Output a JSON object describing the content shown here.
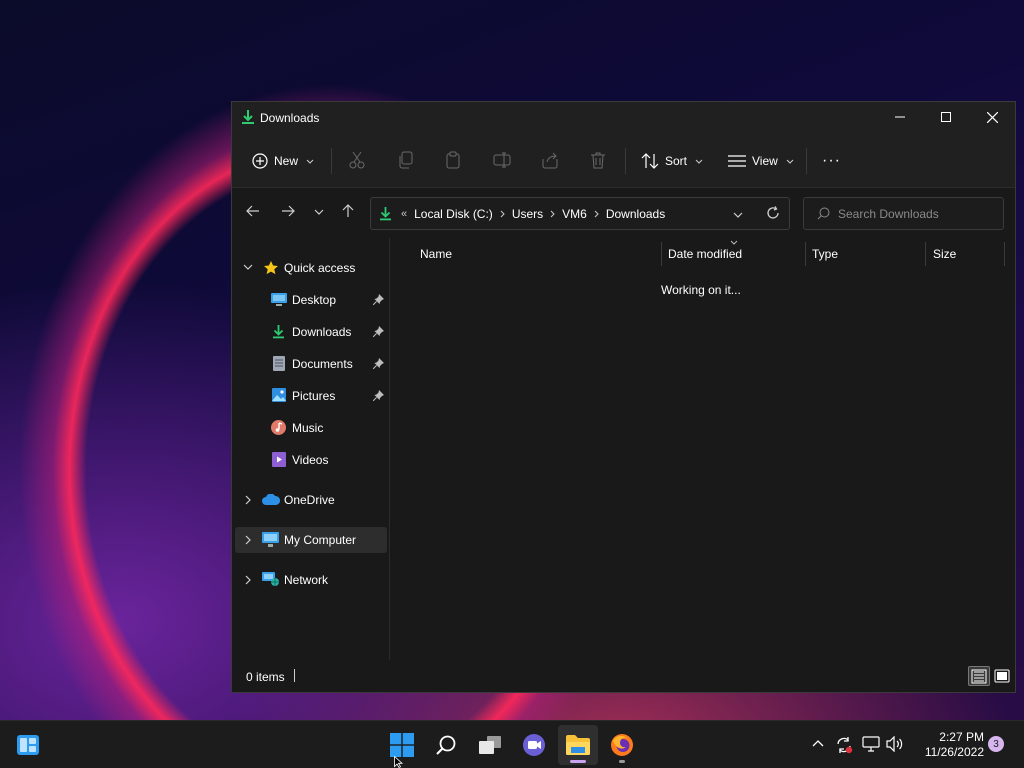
{
  "window": {
    "title": "Downloads"
  },
  "toolbar": {
    "new_label": "New",
    "sort_label": "Sort",
    "view_label": "View",
    "more_label": "···"
  },
  "address": {
    "overflow": "«",
    "crumbs": [
      "Local Disk (C:)",
      "Users",
      "VM6",
      "Downloads"
    ],
    "search_placeholder": "Search Downloads"
  },
  "nav": {
    "quick_access": "Quick access",
    "pinned": [
      "Desktop",
      "Downloads",
      "Documents",
      "Pictures"
    ],
    "music": "Music",
    "videos": "Videos",
    "onedrive": "OneDrive",
    "my_computer": "My Computer",
    "network": "Network"
  },
  "content": {
    "columns": [
      "Name",
      "Date modified",
      "Type",
      "Size"
    ],
    "status_message": "Working on it..."
  },
  "statusbar": {
    "item_count": "0 items"
  },
  "taskbar": {
    "time": "2:27 PM",
    "date": "11/26/2022",
    "notification_count": "3"
  },
  "colors": {
    "accent_green": "#2ecc71",
    "window_bg": "#191919",
    "titlebar_bg": "#202020",
    "taskbar_bg": "#1c1c1c",
    "windows_blue": "#2d9bf0"
  }
}
